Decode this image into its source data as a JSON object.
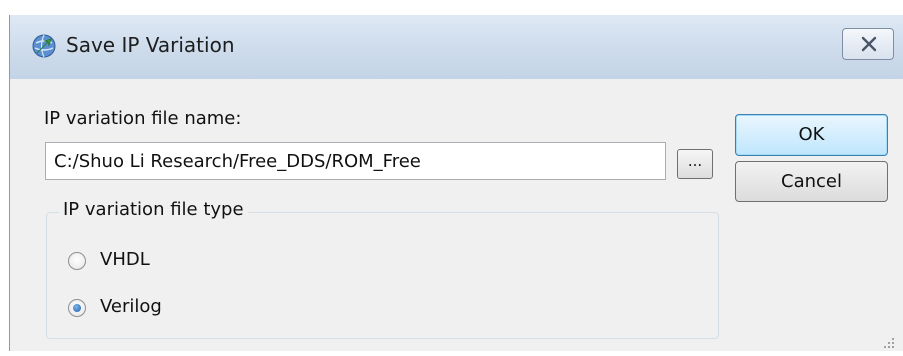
{
  "window": {
    "title": "Save IP Variation",
    "close_glyph": "✕"
  },
  "form": {
    "file_name_label": "IP variation file name:",
    "file_name_value": "C:/Shuo Li Research/Free_DDS/ROM_Free",
    "browse_label": "...",
    "file_type_group_title": "IP variation file type",
    "options": [
      {
        "label": "VHDL",
        "selected": false
      },
      {
        "label": "Verilog",
        "selected": true
      }
    ]
  },
  "buttons": {
    "ok": "OK",
    "cancel": "Cancel"
  },
  "colors": {
    "title_gradient_top": "#dfe9f5",
    "client_bg": "#f0f0f0",
    "ok_border": "#3c7fb1"
  },
  "icons": {
    "app": "globe-arrow-icon",
    "close": "close-icon",
    "grip": "resize-grip-icon"
  }
}
